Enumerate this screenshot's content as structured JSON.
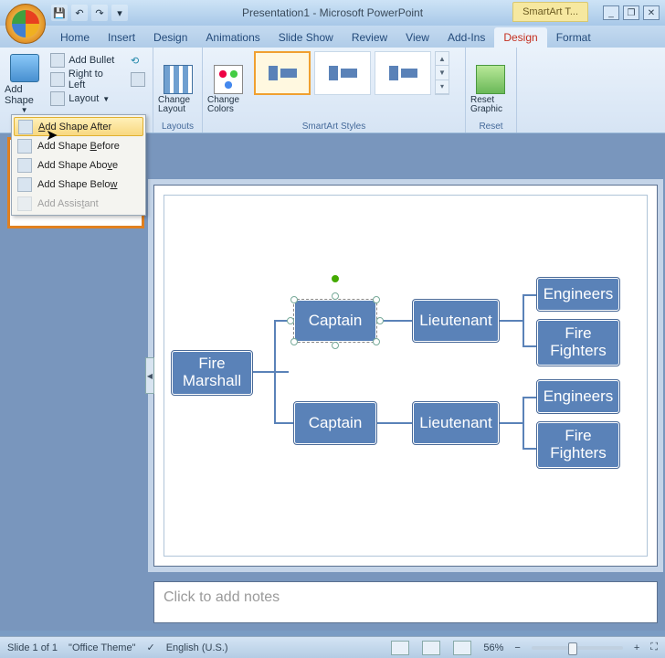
{
  "titlebar": {
    "title": "Presentation1 - Microsoft PowerPoint",
    "contextual_tool": "SmartArt T...",
    "qat": {
      "save": "💾",
      "undo": "↶",
      "redo": "↷",
      "more": "▾"
    },
    "win": {
      "min": "_",
      "restore": "❐",
      "close": "✕"
    }
  },
  "tabs": {
    "items": [
      "Home",
      "Insert",
      "Design",
      "Animations",
      "Slide Show",
      "Review",
      "View",
      "Add-Ins",
      "Design",
      "Format"
    ],
    "active_index": 8
  },
  "ribbon": {
    "create_graphic": {
      "add_shape": "Add Shape",
      "add_bullet": "Add Bullet",
      "rtl": "Right to Left",
      "layout": "Layout",
      "label": ""
    },
    "layouts": {
      "change_layout": "Change Layout",
      "label": "Layouts"
    },
    "styles": {
      "change_colors": "Change Colors",
      "label": "SmartArt Styles"
    },
    "reset": {
      "reset_graphic": "Reset Graphic",
      "label": "Reset"
    }
  },
  "dropdown": {
    "items": [
      {
        "pre": "",
        "u": "A",
        "post": "dd Shape After",
        "hl": true,
        "disabled": false
      },
      {
        "pre": "Add Shape ",
        "u": "B",
        "post": "efore",
        "hl": false,
        "disabled": false
      },
      {
        "pre": "Add Shape Abo",
        "u": "v",
        "post": "e",
        "hl": false,
        "disabled": false
      },
      {
        "pre": "Add Shape Belo",
        "u": "w",
        "post": "",
        "hl": false,
        "disabled": false
      },
      {
        "pre": "Add Assis",
        "u": "t",
        "post": "ant",
        "hl": false,
        "disabled": true
      }
    ]
  },
  "chart_data": {
    "type": "hierarchy",
    "title": "",
    "nodes": [
      {
        "id": "fm",
        "label": "Fire Marshall",
        "level": 0
      },
      {
        "id": "c1",
        "label": "Captain",
        "level": 1,
        "parent": "fm",
        "selected": true
      },
      {
        "id": "c2",
        "label": "Captain",
        "level": 1,
        "parent": "fm"
      },
      {
        "id": "l1",
        "label": "Lieutenant",
        "level": 2,
        "parent": "c1"
      },
      {
        "id": "l2",
        "label": "Lieutenant",
        "level": 2,
        "parent": "c2"
      },
      {
        "id": "e1",
        "label": "Engineers",
        "level": 3,
        "parent": "l1"
      },
      {
        "id": "f1",
        "label": "Fire Fighters",
        "level": 3,
        "parent": "l1"
      },
      {
        "id": "e2",
        "label": "Engineers",
        "level": 3,
        "parent": "l2"
      },
      {
        "id": "f2",
        "label": "Fire Fighters",
        "level": 3,
        "parent": "l2"
      }
    ]
  },
  "notes": {
    "placeholder": "Click to add notes"
  },
  "status": {
    "slide": "Slide 1 of 1",
    "theme": "\"Office Theme\"",
    "lang": "English (U.S.)",
    "zoom": "56%"
  }
}
